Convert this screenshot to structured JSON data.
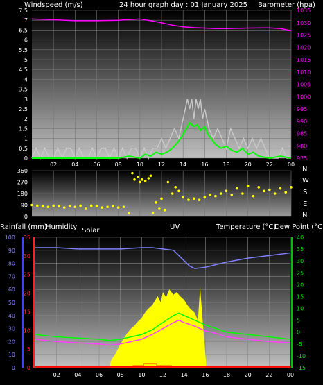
{
  "header": {
    "title": "24 hour graph day : 01 January 2025",
    "left_label": "Windspeed (m/s)",
    "right_label": "Barometer (hpa)"
  },
  "middle": {
    "compass": [
      "N",
      "W",
      "S",
      "E",
      "N"
    ]
  },
  "bottom_header": {
    "rainfall": "Rainfall (mm)",
    "humidity": "Humidity",
    "solar": "Solar",
    "uv": "UV",
    "temperature": "Temperature (°C)",
    "dewpoint": "Dew Point (°C)"
  },
  "x_ticks": [
    "02",
    "04",
    "06",
    "08",
    "10",
    "12",
    "14",
    "16",
    "18",
    "20",
    "22",
    "00"
  ],
  "colors": {
    "wind": "#c8c8c8",
    "wind_avg": "#00ff00",
    "barometer": "#ff00ff",
    "direction": "#ffff00",
    "humidity": "#8080ff",
    "solar": "#ffff00",
    "uv": "#ff8800",
    "temperature": "#ff2040",
    "dewpoint": "#00ff00",
    "temp_line": "#ff40ff",
    "rain": "#ff0000"
  },
  "chart_data": [
    {
      "type": "line",
      "panel": "wind",
      "x_range": [
        0,
        24
      ],
      "y_left": {
        "label": "Windspeed (m/s)",
        "range": [
          0,
          7.5
        ],
        "ticks": [
          "0",
          "0.5",
          "1",
          "1.5",
          "2",
          "2.5",
          "3",
          "3.5",
          "4",
          "4.5",
          "5",
          "5.5",
          "6",
          "6.5",
          "7",
          "7.5"
        ]
      },
      "y_right": {
        "label": "Barometer (hpa)",
        "range": [
          975,
          1035
        ],
        "ticks": [
          "975",
          "980",
          "985",
          "990",
          "995",
          "1000",
          "1005",
          "1010",
          "1015",
          "1020",
          "1025",
          "1030",
          "1035"
        ]
      },
      "series": [
        {
          "key": "gust",
          "axis": "left",
          "x": [
            0,
            0.4,
            0.8,
            1.2,
            1.6,
            2,
            2.4,
            2.8,
            3.2,
            3.6,
            4,
            4.4,
            4.8,
            5.2,
            5.6,
            6,
            6.4,
            6.8,
            7.2,
            7.6,
            8,
            8.4,
            8.8,
            9.2,
            9.6,
            10,
            10.4,
            10.8,
            11.2,
            11.6,
            12,
            12.4,
            12.8,
            13.2,
            13.6,
            14,
            14.2,
            14.4,
            14.6,
            14.8,
            15,
            15.2,
            15.4,
            15.6,
            15.8,
            16,
            16.2,
            16.4,
            16.8,
            17.2,
            17.6,
            18,
            18.4,
            18.8,
            19.2,
            19.6,
            20,
            20.4,
            20.8,
            21.2,
            21.6,
            22,
            22.4,
            22.8,
            23.2,
            23.6,
            24
          ],
          "y": [
            0,
            0.5,
            0,
            0.5,
            0,
            0,
            0.5,
            0,
            0.5,
            0.5,
            0,
            0.5,
            0,
            0,
            0.5,
            0,
            0.5,
            0.5,
            0,
            0.5,
            0,
            0.5,
            0,
            0.5,
            0.5,
            0,
            0.5,
            0,
            0.5,
            0.5,
            1,
            0.5,
            1,
            1.5,
            1,
            2,
            2.5,
            3,
            2.5,
            3,
            2,
            3,
            2.5,
            3,
            2,
            2.5,
            2,
            1.5,
            1,
            1.5,
            1,
            0.5,
            1.5,
            1,
            0.5,
            1,
            0.5,
            1,
            0.5,
            1,
            0.5,
            0,
            0,
            0,
            0.5,
            0,
            0
          ]
        },
        {
          "key": "average",
          "axis": "left",
          "x": [
            0,
            2,
            4,
            6,
            8,
            9,
            10,
            10.5,
            11,
            11.5,
            12,
            12.5,
            13,
            13.5,
            14,
            14.3,
            14.6,
            15,
            15.3,
            15.6,
            16,
            16.3,
            16.6,
            17,
            17.5,
            18,
            18.5,
            19,
            19.5,
            20,
            20.5,
            21,
            22,
            23,
            24
          ],
          "y": [
            0,
            0,
            0,
            0,
            0,
            0.1,
            0,
            0.2,
            0.1,
            0.3,
            0.2,
            0.3,
            0.5,
            0.8,
            1.2,
            1.5,
            1.8,
            1.6,
            1.7,
            1.4,
            1.6,
            1.2,
            1.0,
            0.7,
            0.5,
            0.6,
            0.4,
            0.3,
            0.5,
            0.2,
            0.3,
            0.1,
            0,
            0.1,
            0
          ]
        },
        {
          "key": "barometer",
          "axis": "right",
          "x": [
            0,
            2,
            4,
            6,
            8,
            10,
            11,
            12,
            13,
            14,
            15,
            16,
            17,
            18,
            20,
            22,
            23,
            24
          ],
          "y": [
            1031.5,
            1031.2,
            1030.8,
            1030.8,
            1031.0,
            1031.5,
            1030.8,
            1030.0,
            1029.0,
            1028.3,
            1028.0,
            1027.8,
            1027.6,
            1027.6,
            1027.8,
            1027.9,
            1027.6,
            1026.8
          ]
        }
      ]
    },
    {
      "type": "scatter",
      "panel": "direction",
      "x_range": [
        0,
        24
      ],
      "y_range": [
        0,
        360
      ],
      "y_ticks": [
        "0",
        "90",
        "180",
        "270",
        "360"
      ],
      "series": [
        {
          "key": "direction",
          "x": [
            0,
            0.5,
            1,
            1.5,
            2,
            2.5,
            3,
            3.5,
            4,
            4.5,
            5,
            5.5,
            6,
            6.5,
            7,
            7.5,
            8,
            8.5,
            9,
            9.3,
            9.5,
            9.8,
            10,
            10.2,
            10.5,
            10.8,
            11,
            11.2,
            11.5,
            11.8,
            12,
            12.3,
            12.6,
            13,
            13.3,
            13.6,
            14,
            14.5,
            15,
            15.5,
            16,
            16.5,
            17,
            17.5,
            18,
            18.5,
            19,
            19.5,
            20,
            20.5,
            21,
            21.5,
            22,
            22.5,
            23,
            23.5,
            24
          ],
          "y": [
            90,
            85,
            80,
            75,
            85,
            80,
            70,
            80,
            75,
            85,
            60,
            85,
            80,
            70,
            75,
            80,
            70,
            75,
            25,
            340,
            290,
            310,
            270,
            290,
            280,
            300,
            320,
            30,
            110,
            60,
            140,
            50,
            270,
            180,
            230,
            200,
            150,
            130,
            140,
            130,
            150,
            170,
            160,
            180,
            200,
            170,
            220,
            180,
            240,
            160,
            230,
            200,
            210,
            180,
            220,
            190,
            230
          ]
        }
      ]
    },
    {
      "type": "line",
      "panel": "bottom",
      "x_range": [
        0,
        24
      ],
      "y_humidity": {
        "label": "Humidity",
        "range": [
          0,
          100
        ],
        "ticks": [
          "0",
          "10",
          "20",
          "30",
          "40",
          "50",
          "60",
          "70",
          "80",
          "90",
          "100"
        ]
      },
      "y_rain": {
        "label": "Rainfall (mm)",
        "range": [
          0,
          35
        ],
        "ticks": [
          "0",
          "5",
          "10",
          "15",
          "20",
          "25",
          "30",
          "35"
        ]
      },
      "y_temp": {
        "label": "Temperature (°C)",
        "range": [
          -15,
          40
        ],
        "ticks": [
          "-15",
          "-10",
          "-5",
          "0",
          "5",
          "10",
          "15",
          "20",
          "25",
          "30",
          "35",
          "40"
        ]
      },
      "series": [
        {
          "key": "humidity",
          "axis": "humidity",
          "x": [
            0,
            2,
            4,
            6,
            8,
            10,
            11,
            12,
            13,
            13.5,
            14,
            14.5,
            15,
            16,
            17,
            18,
            20,
            22,
            24
          ],
          "y": [
            92,
            92,
            91,
            91,
            91,
            92,
            92,
            91,
            90,
            86,
            82,
            78,
            76,
            77,
            79,
            81,
            84,
            86,
            88
          ]
        },
        {
          "key": "dewpoint",
          "axis": "temp",
          "x": [
            0,
            2,
            4,
            6,
            7,
            8,
            9,
            10,
            11,
            12,
            13,
            13.5,
            14,
            15,
            16,
            17,
            18,
            20,
            22,
            24
          ],
          "y": [
            -1,
            -2,
            -2.5,
            -3,
            -3.5,
            -3,
            -2,
            -1,
            1,
            4,
            7,
            8,
            7,
            5,
            3,
            1.5,
            0,
            -1,
            -2,
            -3
          ]
        },
        {
          "key": "temperature",
          "axis": "temp",
          "x": [
            0,
            2,
            4,
            6,
            7,
            8,
            9,
            10,
            11,
            12,
            13,
            13.5,
            14,
            15,
            16,
            17,
            18,
            20,
            22,
            24
          ],
          "y": [
            -3,
            -4,
            -4.5,
            -5,
            -5.5,
            -5,
            -4,
            -3,
            -1,
            1.5,
            4,
            5,
            4,
            2.5,
            0.5,
            -0.5,
            -2,
            -3,
            -4,
            -4.5
          ]
        },
        {
          "key": "solar",
          "axis": "solar",
          "x": [
            7,
            7.1,
            7.3,
            7.5,
            7.8,
            8,
            8.3,
            8.6,
            9,
            9.3,
            9.6,
            10,
            10.3,
            10.6,
            11,
            11.3,
            11.5,
            11.8,
            12,
            12.3,
            12.6,
            13,
            13.3,
            13.6,
            14,
            14.3,
            14.6,
            15,
            15.3,
            15.5,
            15.8,
            16,
            16.1
          ],
          "y": [
            0,
            5,
            8,
            10,
            15,
            18,
            22,
            26,
            30,
            32,
            35,
            38,
            42,
            45,
            48,
            52,
            55,
            50,
            58,
            54,
            60,
            56,
            58,
            55,
            52,
            48,
            45,
            42,
            36,
            62,
            30,
            10,
            0
          ]
        },
        {
          "key": "rain",
          "axis": "rain",
          "x": [
            0,
            24
          ],
          "y": [
            0.2,
            0.2
          ]
        }
      ]
    }
  ]
}
